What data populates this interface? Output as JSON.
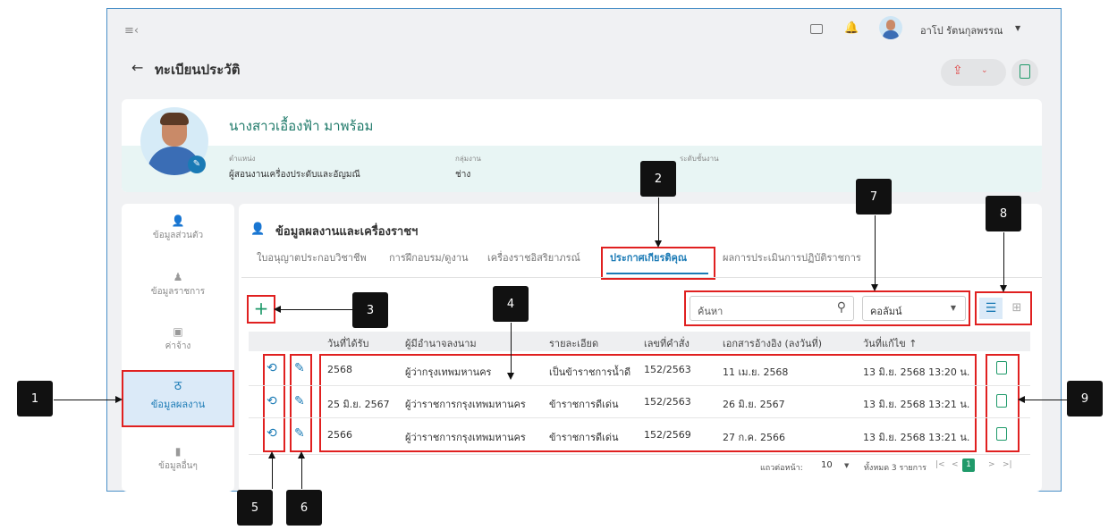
{
  "topbar": {
    "menu_icon": "≡‹",
    "user_name": "อาโป รัตนกุลพรรณ",
    "dropdown_icon": "▼"
  },
  "page": {
    "back_icon": "←",
    "title": "ทะเบียนประวัติ"
  },
  "profile": {
    "name": "นางสาวเอื้องฟ้า มาพร้อม",
    "position_label": "ตำแหน่ง",
    "position_value": "ผู้สอนงานเครื่องประดับและอัญมณี",
    "group_label": "กลุ่มงาน",
    "group_value": "ช่าง",
    "level_label": "ระดับชั้นงาน"
  },
  "sidebar": {
    "items": [
      {
        "label": "ข้อมูลส่วนตัว"
      },
      {
        "label": "ข้อมูลราชการ"
      },
      {
        "label": "ค่าจ้าง"
      },
      {
        "label": "ข้อมูลผลงาน"
      },
      {
        "label": "ข้อมูลอื่นๆ"
      }
    ]
  },
  "section": {
    "title": "ข้อมูลผลงานและเครื่องราชฯ"
  },
  "tabs": [
    {
      "label": "ใบอนุญาตประกอบวิชาชีพ"
    },
    {
      "label": "การฝึกอบรม/ดูงาน"
    },
    {
      "label": "เครื่องราชอิสริยาภรณ์"
    },
    {
      "label": "ประกาศเกียรติคุณ"
    },
    {
      "label": "ผลการประเมินการปฏิบัติราชการ"
    }
  ],
  "toolbar": {
    "add_icon": "+",
    "search_placeholder": "ค้นหา",
    "column_select": "คอลัมน์"
  },
  "table": {
    "headers": [
      "วันที่ได้รับ",
      "ผู้มีอำนาจลงนาม",
      "รายละเอียด",
      "เลขที่คำสั่ง",
      "เอกสารอ้างอิง (ลงวันที่)",
      "วันที่แก้ไข ↑"
    ],
    "rows": [
      [
        "2568",
        "ผู้ว่ากรุงเทพมหานคร",
        "เป็นข้าราชการน้ำดี",
        "152/2563",
        "11 เม.ย. 2568",
        "13 มิ.ย. 2568 13:20 น."
      ],
      [
        "25 มิ.ย. 2567",
        "ผู้ว่าราชการกรุงเทพมหานคร",
        "ข้าราชการดีเด่น",
        "152/2563",
        "26 มิ.ย. 2567",
        "13 มิ.ย. 2568 13:21 น."
      ],
      [
        "2566",
        "ผู้ว่าราชการกรุงเทพมหานคร",
        "ข้าราชการดีเด่น",
        "152/2569",
        "27 ก.ค. 2566",
        "13 มิ.ย. 2568 13:21 น."
      ]
    ]
  },
  "pagination": {
    "rows_per_page_label": "แถวต่อหน้า:",
    "rows_per_page": "10",
    "total": "ทั้งหมด 3 รายการ",
    "first": "|<",
    "prev": "<",
    "page": "1",
    "next": ">",
    "last": ">|"
  },
  "markers": [
    "1",
    "2",
    "3",
    "4",
    "5",
    "6",
    "7",
    "8",
    "9"
  ]
}
